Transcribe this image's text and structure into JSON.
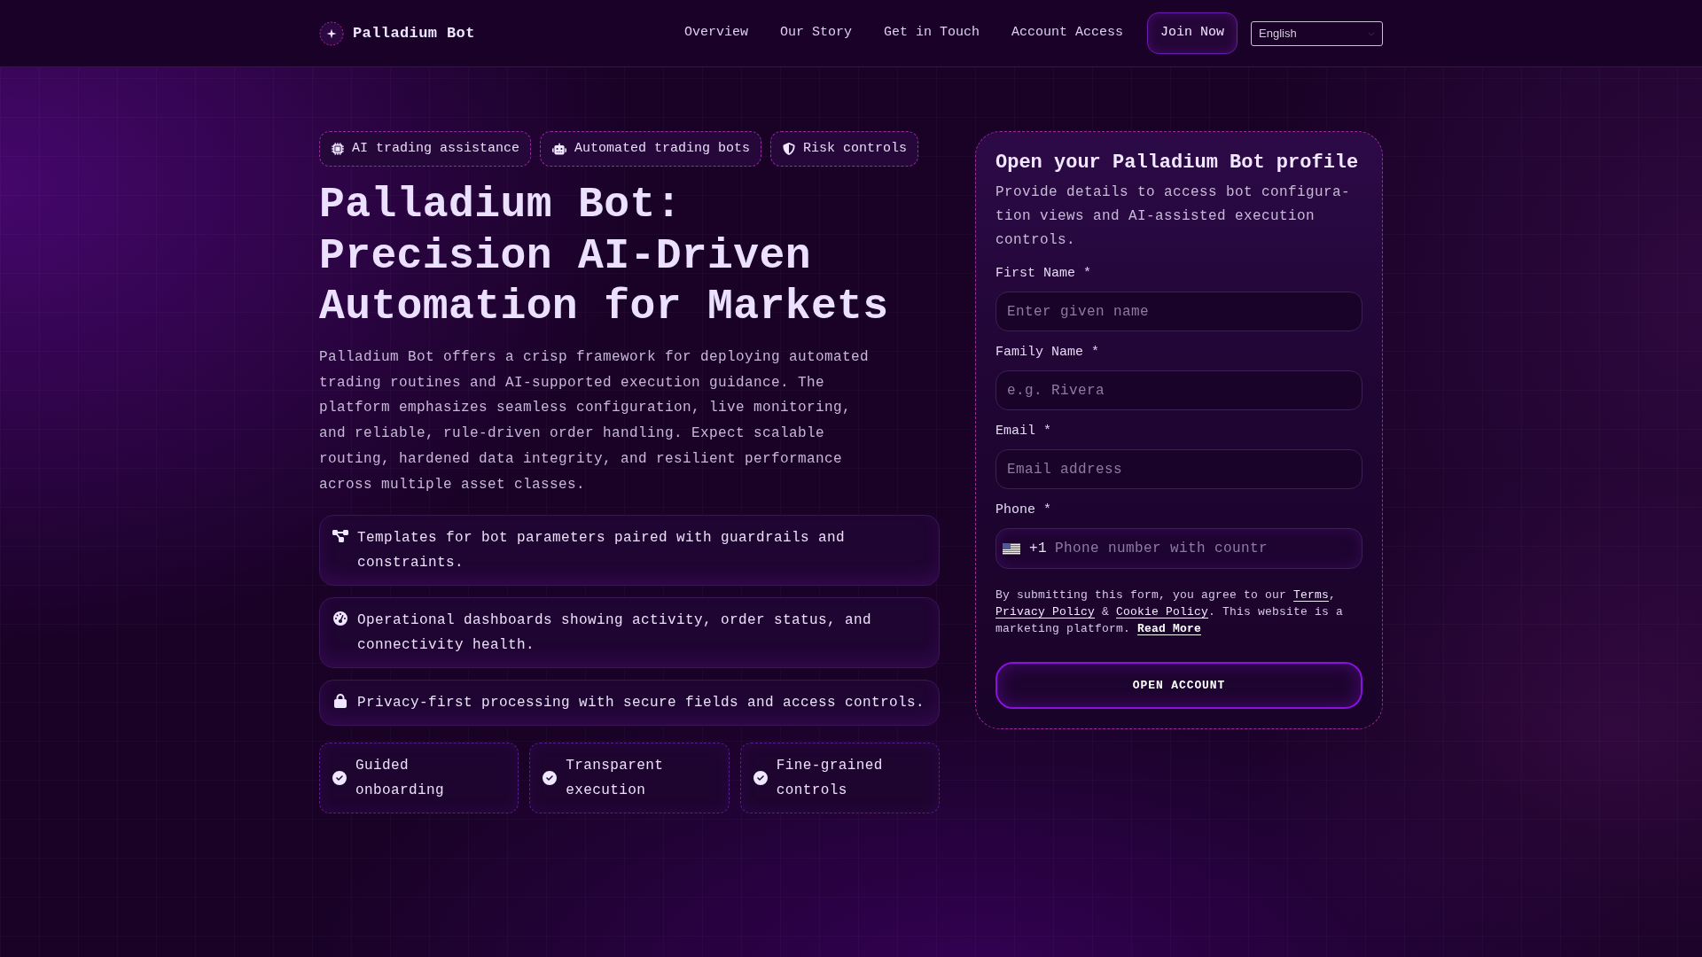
{
  "header": {
    "brand": "Palladium Bot",
    "nav": [
      {
        "label": "Overview"
      },
      {
        "label": "Our Story"
      },
      {
        "label": "Get in Touch"
      },
      {
        "label": "Account Access"
      }
    ],
    "cta": "Join Now",
    "language": "English"
  },
  "hero": {
    "tags": [
      "AI trading assistance",
      "Automated trading bots",
      "Risk controls"
    ],
    "title": "Palladium Bot: Precision AI-Driven Automation for Markets",
    "intro": "Palladium Bot offers a crisp framework for deploying automated trading routines and AI-supported execution guidance. The platform emphasizes seamless configuration, live monitoring, and reliable, rule-driven order handling. Expect scalable routing, hardened data integrity, and resilient performance across multiple asset classes.",
    "features": [
      "Templates for bot parameters paired with guardrails and constraints.",
      "Operational dashboards showing activity, order status, and connectivity health.",
      "Privacy-first processing with secure fields and access controls."
    ],
    "highlights": [
      "Guided onboarding",
      "Transparent execution",
      "Fine-grained controls"
    ]
  },
  "signup": {
    "title": "Open your Palladium Bot profile",
    "description": "Provide details to access bot configura-tion views and AI-assisted execution controls.",
    "fields": [
      {
        "kind": "text",
        "label": "First Name *",
        "placeholder": "Enter given name"
      },
      {
        "kind": "text",
        "label": "Family Name *",
        "placeholder": "e.g. Rivera"
      },
      {
        "kind": "text",
        "label": "Email *",
        "placeholder": "Email address"
      },
      {
        "kind": "phone",
        "label": "Phone *",
        "dial_code": "+1",
        "placeholder": "Phone number with countr"
      }
    ],
    "consent": [
      {
        "kind": "text",
        "text": "By submitting this form, you agree to our "
      },
      {
        "kind": "link",
        "text": "Terms"
      },
      {
        "kind": "text",
        "text": ", "
      },
      {
        "kind": "link",
        "text": "Privacy Policy"
      },
      {
        "kind": "text",
        "text": " & "
      },
      {
        "kind": "link",
        "text": "Cookie Policy"
      },
      {
        "kind": "text",
        "text": ". This website is a marketing platform. "
      },
      {
        "kind": "strong_link",
        "text": "Read More"
      }
    ],
    "submit": "OPEN ACCOUNT"
  }
}
